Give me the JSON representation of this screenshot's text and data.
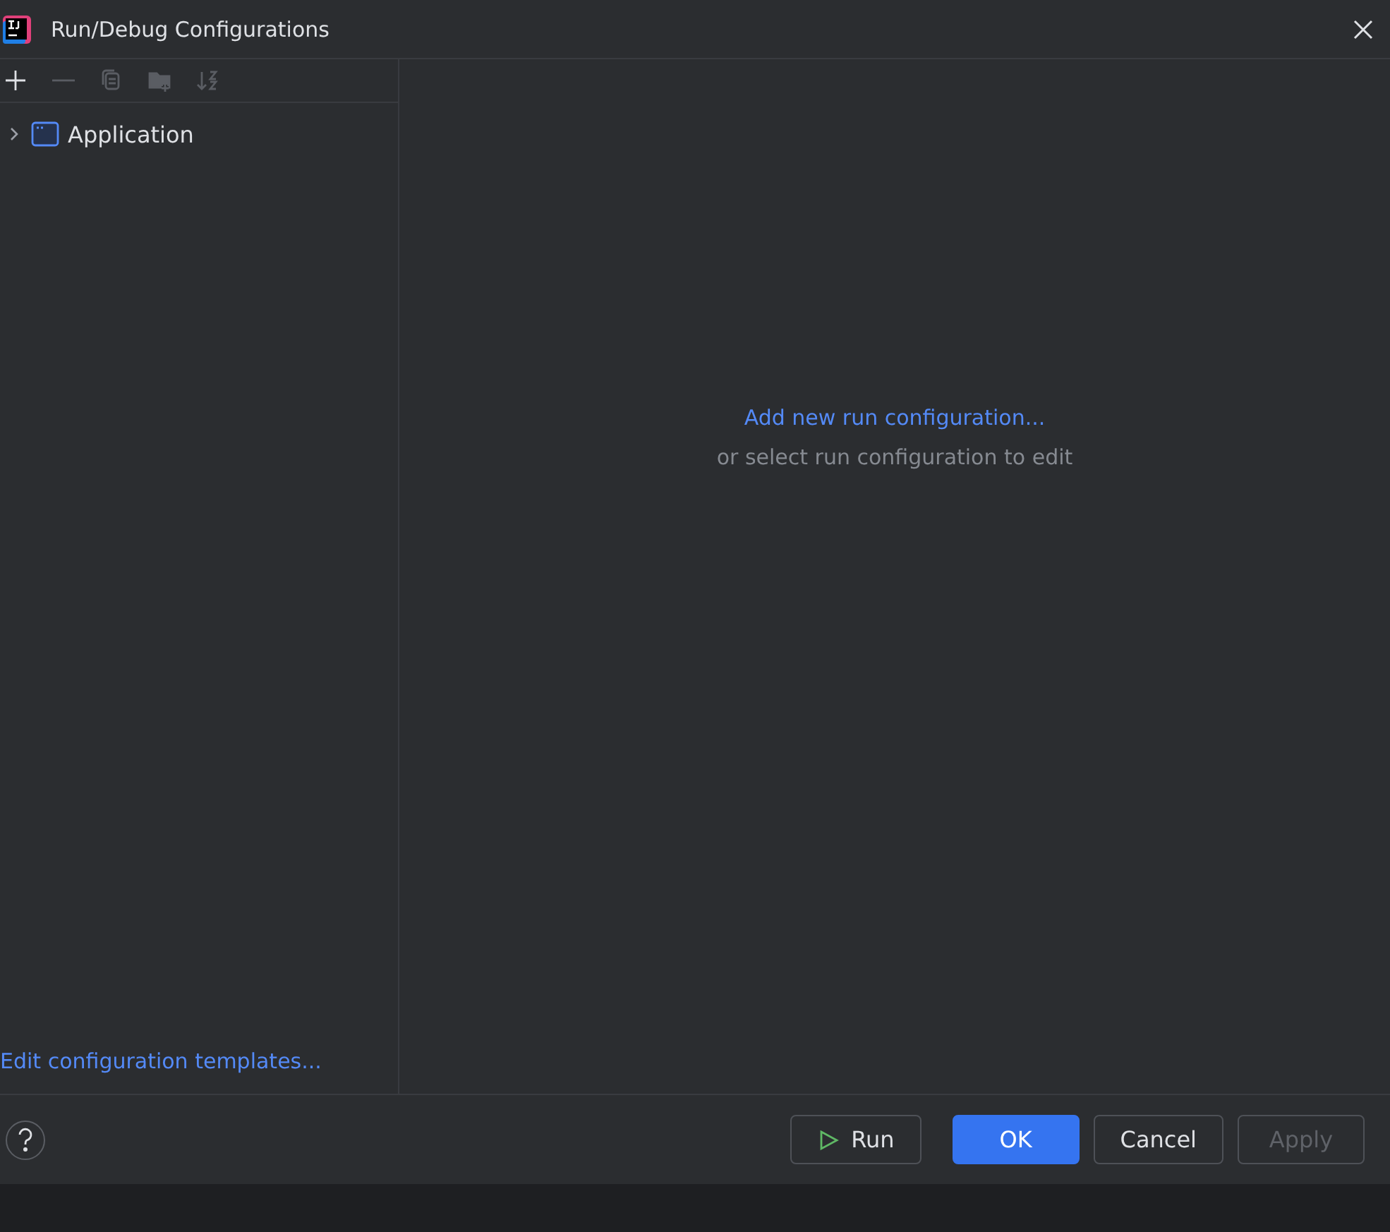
{
  "window": {
    "title": "Run/Debug Configurations"
  },
  "toolbar": [
    {
      "kind": "add",
      "disabled": false
    },
    {
      "kind": "remove",
      "disabled": true
    },
    {
      "kind": "copy",
      "disabled": true
    },
    {
      "kind": "folder",
      "disabled": true
    },
    {
      "kind": "sort",
      "disabled": true
    }
  ],
  "tree": [
    {
      "label": "Application",
      "expanded": false
    }
  ],
  "templates_link": "Edit configuration templates...",
  "empty_state": {
    "link": "Add new run configuration...",
    "hint": "or select run configuration to edit"
  },
  "buttons": [
    {
      "label": "Run",
      "kind": "run",
      "disabled": false
    },
    {
      "label": "OK",
      "kind": "primary",
      "disabled": false
    },
    {
      "label": "Cancel",
      "kind": "plain",
      "disabled": false
    },
    {
      "label": "Apply",
      "kind": "plain",
      "disabled": true
    }
  ]
}
